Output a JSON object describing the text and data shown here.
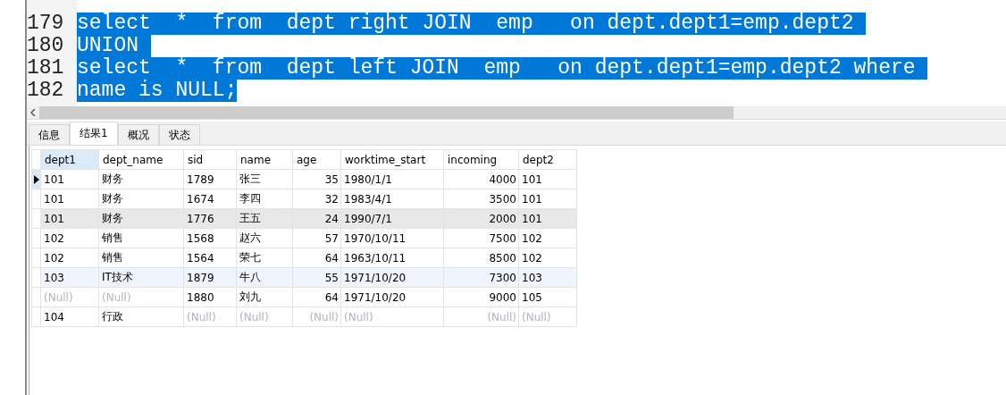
{
  "editor": {
    "lines": [
      {
        "number": "179",
        "text": "select  *  from  dept right JOIN  emp   on dept.dept1=emp.dept2 ",
        "selected": true
      },
      {
        "number": "180",
        "text": "UNION ",
        "selected": true
      },
      {
        "number": "181",
        "text": "select  *  from  dept left JOIN  emp   on dept.dept1=emp.dept2 where ",
        "selected": true
      },
      {
        "number": "182",
        "text": "name is NULL;",
        "selected": true
      }
    ]
  },
  "tabs": [
    {
      "label": "信息",
      "selected": false
    },
    {
      "label": "结果1",
      "selected": true
    },
    {
      "label": "概况",
      "selected": false
    },
    {
      "label": "状态",
      "selected": false
    }
  ],
  "table": {
    "columns": [
      {
        "label": "dept1",
        "kind": "text",
        "selected": true
      },
      {
        "label": "dept_name",
        "kind": "text",
        "selected": false
      },
      {
        "label": "sid",
        "kind": "text",
        "selected": false
      },
      {
        "label": "name",
        "kind": "text",
        "selected": false
      },
      {
        "label": "age",
        "kind": "number",
        "selected": false
      },
      {
        "label": "worktime_start",
        "kind": "text",
        "selected": false
      },
      {
        "label": "incoming",
        "kind": "number",
        "selected": false
      },
      {
        "label": "dept2",
        "kind": "text",
        "selected": false
      }
    ],
    "rows": [
      {
        "current": true,
        "hovered": false,
        "selected": false,
        "cells": [
          {
            "v": "101",
            "null": false
          },
          {
            "v": "财务",
            "null": false
          },
          {
            "v": "1789",
            "null": false
          },
          {
            "v": "张三",
            "null": false
          },
          {
            "v": "35",
            "null": false
          },
          {
            "v": "1980/1/1",
            "null": false
          },
          {
            "v": "4000",
            "null": false
          },
          {
            "v": "101",
            "null": false
          }
        ]
      },
      {
        "current": false,
        "hovered": false,
        "selected": false,
        "cells": [
          {
            "v": "101",
            "null": false
          },
          {
            "v": "财务",
            "null": false
          },
          {
            "v": "1674",
            "null": false
          },
          {
            "v": "李四",
            "null": false
          },
          {
            "v": "32",
            "null": false
          },
          {
            "v": "1983/4/1",
            "null": false
          },
          {
            "v": "3500",
            "null": false
          },
          {
            "v": "101",
            "null": false
          }
        ]
      },
      {
        "current": false,
        "hovered": true,
        "selected": false,
        "cells": [
          {
            "v": "101",
            "null": false
          },
          {
            "v": "财务",
            "null": false
          },
          {
            "v": "1776",
            "null": false
          },
          {
            "v": "王五",
            "null": false
          },
          {
            "v": "24",
            "null": false
          },
          {
            "v": "1990/7/1",
            "null": false
          },
          {
            "v": "2000",
            "null": false
          },
          {
            "v": "101",
            "null": false
          }
        ]
      },
      {
        "current": false,
        "hovered": false,
        "selected": false,
        "cells": [
          {
            "v": "102",
            "null": false
          },
          {
            "v": "销售",
            "null": false
          },
          {
            "v": "1568",
            "null": false
          },
          {
            "v": "赵六",
            "null": false
          },
          {
            "v": "57",
            "null": false
          },
          {
            "v": "1970/10/11",
            "null": false
          },
          {
            "v": "7500",
            "null": false
          },
          {
            "v": "102",
            "null": false
          }
        ]
      },
      {
        "current": false,
        "hovered": false,
        "selected": false,
        "cells": [
          {
            "v": "102",
            "null": false
          },
          {
            "v": "销售",
            "null": false
          },
          {
            "v": "1564",
            "null": false
          },
          {
            "v": "荣七",
            "null": false
          },
          {
            "v": "64",
            "null": false
          },
          {
            "v": "1963/10/11",
            "null": false
          },
          {
            "v": "8500",
            "null": false
          },
          {
            "v": "102",
            "null": false
          }
        ]
      },
      {
        "current": false,
        "hovered": false,
        "selected": true,
        "cells": [
          {
            "v": "103",
            "null": false
          },
          {
            "v": "IT技术",
            "null": false
          },
          {
            "v": "1879",
            "null": false
          },
          {
            "v": "牛八",
            "null": false
          },
          {
            "v": "55",
            "null": false
          },
          {
            "v": "1971/10/20",
            "null": false
          },
          {
            "v": "7300",
            "null": false
          },
          {
            "v": "103",
            "null": false
          }
        ]
      },
      {
        "current": false,
        "hovered": false,
        "selected": false,
        "cells": [
          {
            "v": "(Null)",
            "null": true
          },
          {
            "v": "(Null)",
            "null": true
          },
          {
            "v": "1880",
            "null": false
          },
          {
            "v": "刘九",
            "null": false
          },
          {
            "v": "64",
            "null": false
          },
          {
            "v": "1971/10/20",
            "null": false
          },
          {
            "v": "9000",
            "null": false
          },
          {
            "v": "105",
            "null": false
          }
        ]
      },
      {
        "current": false,
        "hovered": false,
        "selected": false,
        "cells": [
          {
            "v": "104",
            "null": false
          },
          {
            "v": "行政",
            "null": false
          },
          {
            "v": "(Null)",
            "null": true
          },
          {
            "v": "(Null)",
            "null": true
          },
          {
            "v": "(Null)",
            "null": true
          },
          {
            "v": "(Null)",
            "null": true
          },
          {
            "v": "(Null)",
            "null": true
          },
          {
            "v": "(Null)",
            "null": true
          }
        ]
      }
    ]
  }
}
